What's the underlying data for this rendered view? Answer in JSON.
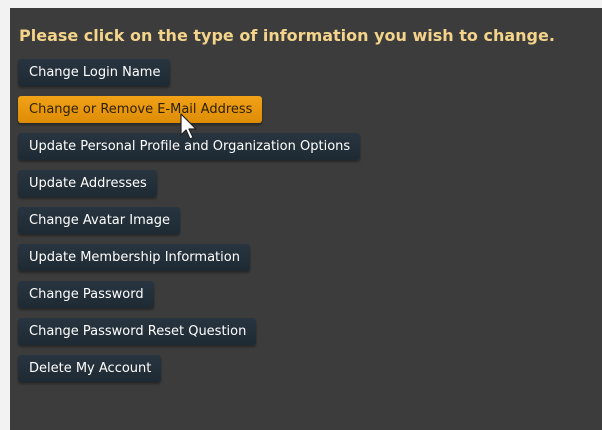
{
  "heading": "Please click on the type of information you wish to change.",
  "options": [
    {
      "label": "Change Login Name",
      "active": false
    },
    {
      "label": "Change or Remove E-Mail Address",
      "active": true
    },
    {
      "label": "Update Personal Profile and Organization Options",
      "active": false
    },
    {
      "label": "Update Addresses",
      "active": false
    },
    {
      "label": "Change Avatar Image",
      "active": false
    },
    {
      "label": "Update Membership Information",
      "active": false
    },
    {
      "label": "Change Password",
      "active": false
    },
    {
      "label": "Change Password Reset Question",
      "active": false
    },
    {
      "label": "Delete My Account",
      "active": false
    }
  ],
  "colors": {
    "panel_bg": "#3c3c3c",
    "heading": "#f3d48a",
    "button_bg": "#243039",
    "button_active_bg": "#ea9810"
  },
  "icons": {
    "cursor": "mouse-pointer-icon"
  }
}
